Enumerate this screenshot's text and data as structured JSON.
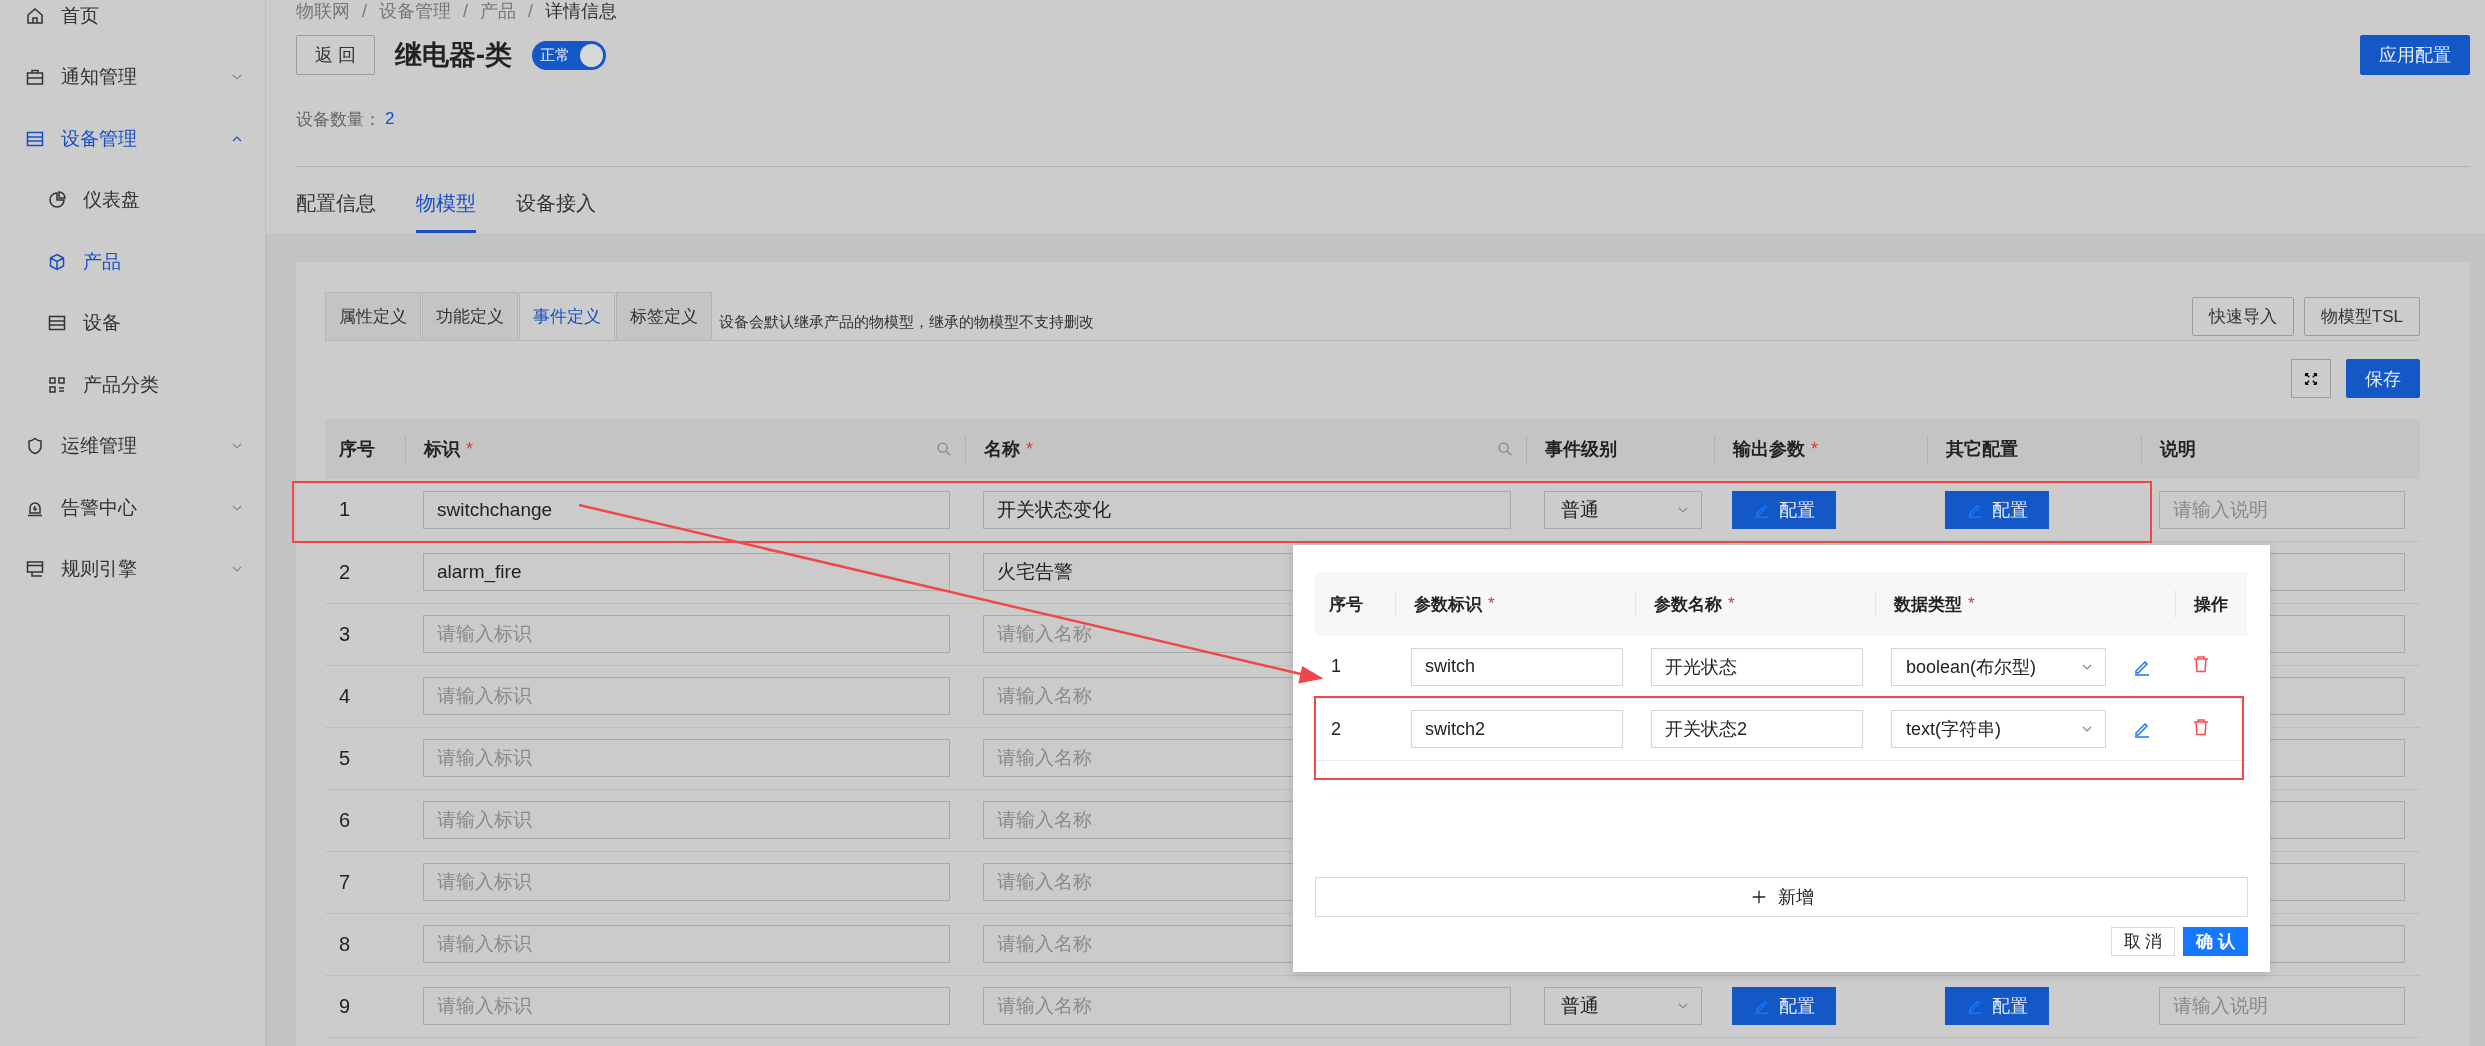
{
  "sidebar": {
    "items": [
      {
        "label": "首页",
        "kind": "link",
        "selected": false
      },
      {
        "label": "通知管理",
        "kind": "group",
        "selected": false,
        "expanded": false
      },
      {
        "label": "设备管理",
        "kind": "group",
        "selected": true,
        "expanded": true,
        "children": [
          {
            "label": "仪表盘",
            "selected": false
          },
          {
            "label": "产品",
            "selected": true
          },
          {
            "label": "设备",
            "selected": false
          },
          {
            "label": "产品分类",
            "selected": false
          }
        ]
      },
      {
        "label": "运维管理",
        "kind": "group",
        "selected": false,
        "expanded": false
      },
      {
        "label": "告警中心",
        "kind": "group",
        "selected": false,
        "expanded": false
      },
      {
        "label": "规则引擎",
        "kind": "group",
        "selected": false,
        "expanded": false
      }
    ]
  },
  "breadcrumb": {
    "separator": "/",
    "items": [
      "物联网",
      "设备管理",
      "产品",
      "详情信息"
    ]
  },
  "header": {
    "back_button": "返 回",
    "title": "继电器-类",
    "status_switch": {
      "label": "正常",
      "on": true
    },
    "apply_button": "应用配置"
  },
  "device_count": {
    "label": "设备数量：",
    "value": "2"
  },
  "tabs": [
    {
      "label": "配置信息",
      "selected": false
    },
    {
      "label": "物模型",
      "selected": true
    },
    {
      "label": "设备接入",
      "selected": false
    }
  ],
  "sub_tabs": [
    {
      "label": "属性定义",
      "selected": false
    },
    {
      "label": "功能定义",
      "selected": false
    },
    {
      "label": "事件定义",
      "selected": true
    },
    {
      "label": "标签定义",
      "selected": false
    }
  ],
  "sub_tabs_note": "设备会默认继承产品的物模型，继承的物模型不支持删改",
  "toolbar": {
    "buttons": [
      "快速导入",
      "物模型TSL"
    ],
    "save_button": "保存"
  },
  "table": {
    "columns": [
      {
        "label": "序号",
        "searchable": false
      },
      {
        "label": "标识",
        "required_mark": "*",
        "searchable": true
      },
      {
        "label": "名称",
        "required_mark": "*",
        "searchable": true
      },
      {
        "label": "事件级别",
        "searchable": false
      },
      {
        "label": "输出参数",
        "required_mark": "*",
        "searchable": false
      },
      {
        "label": "其它配置",
        "searchable": false
      },
      {
        "label": "说明",
        "searchable": false
      }
    ],
    "rows": [
      {
        "index": "1",
        "identifier": {
          "value": "switchchange"
        },
        "name": {
          "value": "开关状态变化"
        },
        "level": "普通",
        "output_button": "配置",
        "other_button": "配置",
        "description": {
          "placeholder": "请输入说明"
        },
        "highlighted": true
      },
      {
        "index": "2",
        "identifier": {
          "value": "alarm_fire"
        },
        "name": {
          "value": "火宅告警"
        },
        "highlighted": false
      },
      {
        "index": "3",
        "identifier": {
          "placeholder": "请输入标识"
        },
        "name": {
          "placeholder": "请输入名称"
        },
        "highlighted": false
      },
      {
        "index": "4",
        "identifier": {
          "placeholder": "请输入标识"
        },
        "name": {
          "placeholder": "请输入名称"
        },
        "highlighted": false
      },
      {
        "index": "5",
        "identifier": {
          "placeholder": "请输入标识"
        },
        "name": {
          "placeholder": "请输入名称"
        },
        "highlighted": false
      },
      {
        "index": "6",
        "identifier": {
          "placeholder": "请输入标识"
        },
        "name": {
          "placeholder": "请输入名称"
        },
        "highlighted": false
      },
      {
        "index": "7",
        "identifier": {
          "placeholder": "请输入标识"
        },
        "name": {
          "placeholder": "请输入名称"
        },
        "highlighted": false
      },
      {
        "index": "8",
        "identifier": {
          "placeholder": "请输入标识"
        },
        "name": {
          "placeholder": "请输入名称"
        },
        "highlighted": false
      },
      {
        "index": "9",
        "identifier": {
          "placeholder": "请输入标识"
        },
        "name": {
          "placeholder": "请输入名称"
        },
        "level": "普通",
        "output_button": "配置",
        "other_button": "配置",
        "description": {
          "placeholder": "请输入说明"
        },
        "highlighted": false
      }
    ]
  },
  "param_dialog": {
    "columns": [
      {
        "label": "序号"
      },
      {
        "label": "参数标识",
        "required_mark": "*"
      },
      {
        "label": "参数名称",
        "required_mark": "*"
      },
      {
        "label": "数据类型",
        "required_mark": "*"
      },
      {
        "label": "操作"
      }
    ],
    "rows": [
      {
        "index": "1",
        "identifier": "switch",
        "name": "开光状态",
        "type": "boolean(布尔型)",
        "highlighted": false
      },
      {
        "index": "2",
        "identifier": "switch2",
        "name": "开关状态2",
        "type": "text(字符串)",
        "highlighted": true
      }
    ],
    "add_button": "新增",
    "cancel_button": "取 消",
    "confirm_button": "确 认"
  }
}
